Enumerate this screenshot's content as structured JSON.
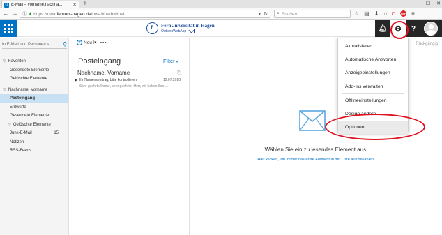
{
  "browser": {
    "tab_title": "E-Mail – vorname.nachna...",
    "tab_favicon": "O",
    "url_prefix": "https://owa.",
    "url_domain": "fernuni-hagen.de",
    "url_suffix": "/owa/#path=/mail",
    "search_placeholder": "Suchen",
    "abp_label": "ABP"
  },
  "header": {
    "brand_name": "FernUniversität in Hagen",
    "brand_sub": "OutlookWebApp",
    "help_label": "?"
  },
  "leftnav": {
    "search_placeholder": "In E-Mail und Personen s...",
    "favorites_label": "Favoriten",
    "favorites": [
      {
        "label": "Gesendete Elemente"
      },
      {
        "label": "Gelöschte Elemente"
      }
    ],
    "account_label": "Nachname, Vorname",
    "folders": [
      {
        "label": "Posteingang",
        "active": true
      },
      {
        "label": "Entwürfe"
      },
      {
        "label": "Gesendete Elemente"
      }
    ],
    "deleted_group_label": "Gelöschte Elemente",
    "deleted_children": [
      {
        "label": "Junk-E-Mail",
        "count": "15"
      },
      {
        "label": "Notizen"
      },
      {
        "label": "RSS-Feeds"
      }
    ]
  },
  "mid": {
    "new_label": "Neu",
    "more_label": "•••",
    "inbox_title": "Posteingang",
    "filter_label": "Filter",
    "message": {
      "from": "Nachname, Vorname",
      "subject": "Ihr Namenseintrag, bitte kontrollieren",
      "date": "12.07.2018",
      "preview": "Sehr geehrte Dame, sehr geehrter Herr,    wir haben Ihre ..."
    }
  },
  "reading": {
    "undo_label": "Rückgängig",
    "main_text": "Wählen Sie ein zu lesendes Element aus.",
    "link_text": "Hier klicken, um immer das erste Element in der Liste auszuwählen."
  },
  "settings_menu": {
    "items": [
      "Aktualisieren",
      "Automatische Antworten",
      "Anzeigeeinstellungen",
      "Add-Ins verwalten",
      "Offlineeinstellungen",
      "Design ändern",
      "Optionen"
    ]
  },
  "colors": {
    "owa_blue": "#0072c6",
    "annotation_red": "#e0101e",
    "header_dark": "#262626",
    "selection": "#c7e0f4"
  }
}
